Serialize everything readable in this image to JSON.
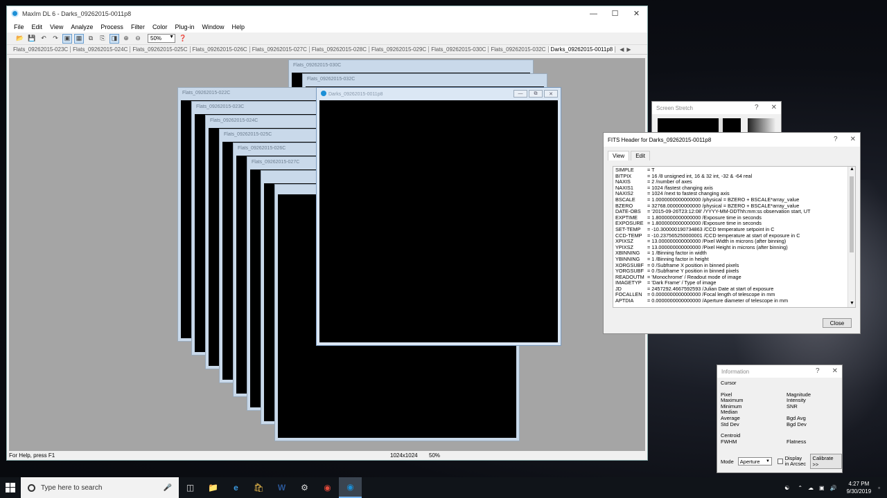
{
  "app": {
    "title": "MaxIm DL 6 - Darks_09262015-0011p8",
    "menu": [
      "File",
      "Edit",
      "View",
      "Analyze",
      "Process",
      "Filter",
      "Color",
      "Plug-in",
      "Window",
      "Help"
    ],
    "zoom": "50%",
    "tabs": [
      "Flats_09262015-023C",
      "Flats_09262015-024C",
      "Flats_09262015-025C",
      "Flats_09262015-026C",
      "Flats_09262015-027C",
      "Flats_09262015-028C",
      "Flats_09262015-029C",
      "Flats_09262015-030C",
      "Flats_09262015-032C",
      "Darks_09262015-0011p8"
    ],
    "status": {
      "help": "For Help, press F1",
      "size": "1024x1024",
      "zoom": "50%"
    }
  },
  "children": {
    "c022": "Flats_09262015-022C",
    "c023": "Flats_09262015-023C",
    "c024": "Flats_09262015-024C",
    "c025": "Flats_09262015-025C",
    "c026": "Flats_09262015-026C",
    "c027": "Flats_09262015-027C",
    "c030": "Flats_09262015-030C",
    "c032": "Flats_09262015-032C",
    "active": "Darks_09262015-0011p8"
  },
  "screen_stretch": {
    "title": "Screen Stretch"
  },
  "fits": {
    "title": "FITS Header for Darks_09262015-0011p8",
    "tabs": [
      "View",
      "Edit"
    ],
    "close": "Close",
    "rows": [
      {
        "k": "SIMPLE",
        "v": "= T"
      },
      {
        "k": "BITPIX",
        "v": "= 16 /8 unsigned int, 16 & 32 int, -32 & -64 real"
      },
      {
        "k": "NAXIS",
        "v": "= 2 /number of axes"
      },
      {
        "k": "NAXIS1",
        "v": "= 1024 /fastest changing axis"
      },
      {
        "k": "NAXIS2",
        "v": "= 1024 /next to fastest changing axis"
      },
      {
        "k": "BSCALE",
        "v": "= 1.0000000000000000 /physical = BZERO + BSCALE*array_value"
      },
      {
        "k": "BZERO",
        "v": "= 32768.000000000000 /physical = BZERO + BSCALE*array_value"
      },
      {
        "k": "DATE-OBS",
        "v": "= '2015-09-26T23:12:08' /YYYY-MM-DDThh:mm:ss observation start, UT"
      },
      {
        "k": "EXPTIME",
        "v": "= 1.8000000000000000 /Exposure time in seconds"
      },
      {
        "k": "EXPOSURE",
        "v": "= 1.8000000000000000 /Exposure time in seconds"
      },
      {
        "k": "SET-TEMP",
        "v": "= -10.300000190734863 /CCD temperature setpoint in C"
      },
      {
        "k": "CCD-TEMP",
        "v": "= -10.237565250000001 /CCD temperature at start of exposure in C"
      },
      {
        "k": "XPIXSZ",
        "v": "= 13.000000000000000 /Pixel Width in microns (after binning)"
      },
      {
        "k": "YPIXSZ",
        "v": "= 13.000000000000000 /Pixel Height in microns (after binning)"
      },
      {
        "k": "XBINNING",
        "v": "= 1 /Binning factor in width"
      },
      {
        "k": "YBINNING",
        "v": "= 1 /Binning factor in height"
      },
      {
        "k": "XORGSUBF",
        "v": "= 0 /Subframe X position in binned pixels"
      },
      {
        "k": "YORGSUBF",
        "v": "= 0 /Subframe Y position in binned pixels"
      },
      {
        "k": "READOUTM",
        "v": "= 'Monochrome' /        Readout mode of image"
      },
      {
        "k": "IMAGETYP",
        "v": "= 'Dark Frame' /      Type of image"
      },
      {
        "k": "JD",
        "v": "= 2457292.4667592593 /Julian Date at start of exposure"
      },
      {
        "k": "FOCALLEN",
        "v": "= 0.0000000000000000 /Focal length of telescope in mm"
      },
      {
        "k": "APTDIA",
        "v": "= 0.0000000000000000 /Aperture diameter of telescope in mm"
      }
    ]
  },
  "info": {
    "title": "Information",
    "cursor": "Cursor",
    "rows": [
      [
        "Pixel",
        "Magnitude"
      ],
      [
        "Maximum",
        "Intensity"
      ],
      [
        "Minimum",
        "SNR"
      ],
      [
        "Median",
        ""
      ],
      [
        "Average",
        "Bgd Avg"
      ],
      [
        "Std Dev",
        "Bgd Dev"
      ]
    ],
    "centroid": "Centroid",
    "fwhm": "FWHM",
    "flatness": "Flatness",
    "mode_label": "Mode",
    "mode_value": "Aperture",
    "display_arcsec": "Display in Arcsec",
    "calibrate": "Calibrate >>"
  },
  "taskbar": {
    "search_placeholder": "Type here to search",
    "time": "4:27 PM",
    "date": "9/30/2019"
  }
}
